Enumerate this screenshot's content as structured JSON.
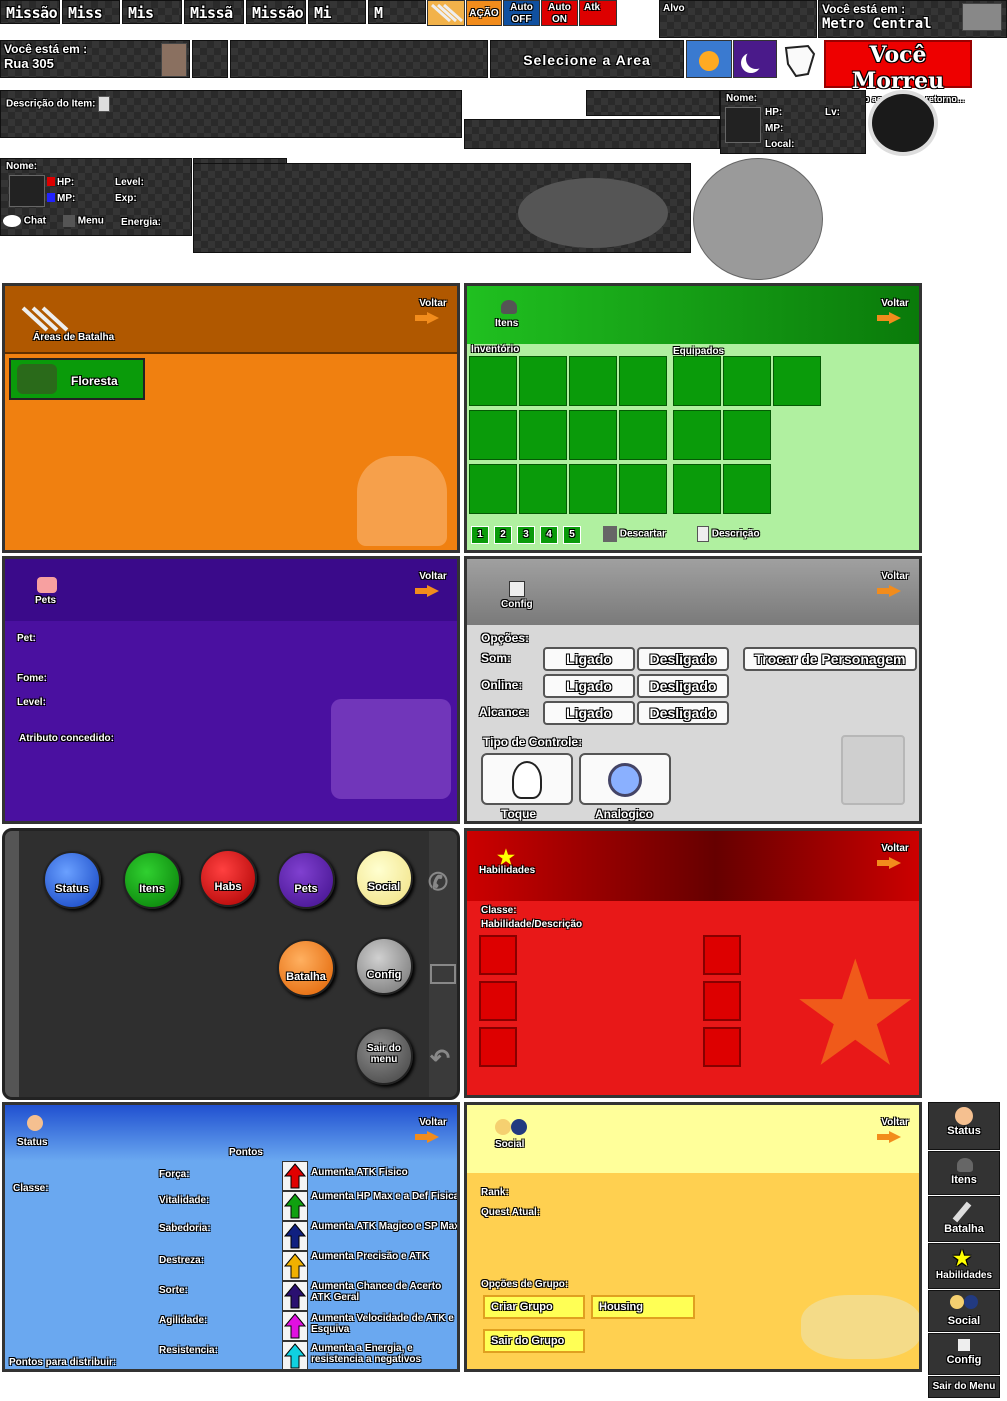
{
  "top_tabs": [
    "Missão",
    "Miss",
    "Mis",
    "Missã",
    "Missão",
    "Mi",
    "M"
  ],
  "top_buttons": {
    "acao": "AÇÃO",
    "auto_off": "Auto OFF",
    "auto_on": "Auto ON",
    "atk": "Atk",
    "alvo": "Alvo"
  },
  "location1": {
    "label": "Você está em :",
    "value": "Metro Central"
  },
  "location2": {
    "label": "Você está em :",
    "value": "Rua 305"
  },
  "select_area": "Selecione a Area",
  "death": {
    "title": "Você Morreu",
    "subtitle": "Voltando ao ponto de retorno..."
  },
  "item_desc_label": "Descrição do Item:",
  "target_info": {
    "nome": "Nome:",
    "hp": "HP:",
    "lv": "Lv:",
    "mp": "MP:",
    "local": "Local:"
  },
  "player_hud": {
    "nome": "Nome:",
    "hp": "HP:",
    "mp": "MP:",
    "level": "Level:",
    "exp": "Exp:",
    "chat": "Chat",
    "menu": "Menu",
    "energia": "Energia:"
  },
  "batalha": {
    "title": "Áreas de Batalha",
    "voltar": "Voltar",
    "area": "Floresta"
  },
  "itens": {
    "title": "Itens",
    "voltar": "Voltar",
    "inventario": "Inventório",
    "equipados": "Equipados",
    "pages": [
      "1",
      "2",
      "3",
      "4",
      "5"
    ],
    "descartar": "Descartar",
    "descricao": "Descrição"
  },
  "pets": {
    "title": "Pets",
    "voltar": "Voltar",
    "pet": "Pet:",
    "fome": "Fome:",
    "level": "Level:",
    "atributo": "Atributo concedido:"
  },
  "config": {
    "title": "Config",
    "voltar": "Voltar",
    "opcoes": "Opções:",
    "som": "Som:",
    "online": "Online:",
    "alcance": "Alcance:",
    "ligado": "Ligado",
    "desligado": "Desligado",
    "trocar": "Trocar de Personagem",
    "tipo": "Tipo de Controle:",
    "toque": "Toque",
    "analogico": "Analogico"
  },
  "phone": {
    "status": "Status",
    "itens": "Itens",
    "habs": "Habs",
    "pets": "Pets",
    "social": "Social",
    "batalha": "Batalha",
    "config": "Config",
    "sair": "Sair do menu"
  },
  "habilidades": {
    "title": "Habilidades",
    "voltar": "Voltar",
    "classe": "Classe:",
    "hab_desc": "Habilidade/Descrição"
  },
  "status": {
    "title": "Status",
    "voltar": "Voltar",
    "pontos": "Pontos",
    "classe": "Classe:",
    "distribuir": "Pontos para distribuir:",
    "stats": [
      {
        "name": "Força:",
        "desc": "Aumenta ATK Fisico",
        "color": "#e00000"
      },
      {
        "name": "Vitalidade:",
        "desc": "Aumenta HP Max e a Def Fisica",
        "color": "#10a010"
      },
      {
        "name": "Sabedoria:",
        "desc": "Aumenta ATK Magico e SP Max",
        "color": "#102080"
      },
      {
        "name": "Destreza:",
        "desc": "Aumenta Precisão e ATK",
        "color": "#f0b000"
      },
      {
        "name": "Sorte:",
        "desc": "Aumenta Chance de Acerto ATK Geral",
        "color": "#2a1070"
      },
      {
        "name": "Agilidade:",
        "desc": "Aumenta Velocidade de ATK e Esquiva",
        "color": "#e010e0"
      },
      {
        "name": "Resistencia:",
        "desc": "Aumenta a Energia, e resistencia a negativos",
        "color": "#10d0e0"
      }
    ]
  },
  "social": {
    "title": "Social",
    "voltar": "Voltar",
    "rank": "Rank:",
    "quest": "Quest Atual:",
    "opcoes": "Opções de Grupo:",
    "criar": "Criar Grupo",
    "housing": "Housing",
    "sair": "Sair do Grupo"
  },
  "sidebar": [
    "Status",
    "Itens",
    "Batalha",
    "Habilidades",
    "Social",
    "Config",
    "Sair do Menu"
  ]
}
